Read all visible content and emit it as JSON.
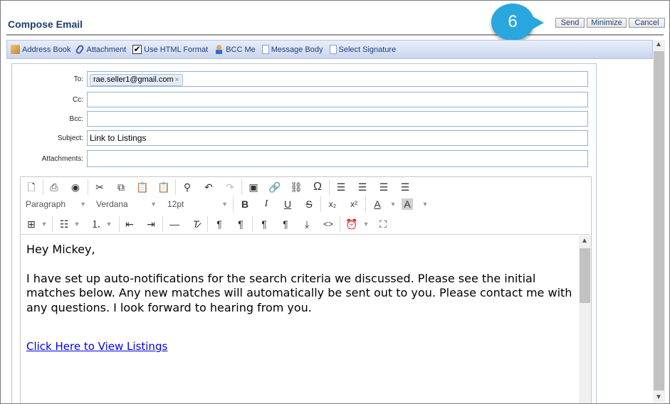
{
  "header": {
    "title": "Compose Email",
    "send_label": "Send",
    "minimize_label": "Minimize",
    "cancel_label": "Cancel",
    "step_number": "6"
  },
  "toolbar": {
    "address_book": "Address Book",
    "attachment": "Attachment",
    "use_html": "Use HTML Format",
    "use_html_checked": true,
    "bcc_me": "BCC Me",
    "message_body": "Message Body",
    "select_signature": "Select Signature"
  },
  "form": {
    "to_label": "To:",
    "to_recipient": "rae.seller1@gmail.com",
    "cc_label": "Cc:",
    "cc_value": "",
    "bcc_label": "Bcc:",
    "bcc_value": "",
    "subject_label": "Subject:",
    "subject_value": "Link to Listings",
    "attachments_label": "Attachments:",
    "attachments_value": ""
  },
  "editor": {
    "paragraph_format": "Paragraph",
    "font_family": "Verdana",
    "font_size": "12pt",
    "greeting": "Hey Mickey,",
    "body": "I have set up auto-notifications for the search criteria we discussed. Please see the initial matches below. Any new matches will automatically be sent out to you. Please contact me with any questions. I look forward to hearing from you.",
    "link_text": "Click Here to View Listings"
  },
  "icons": [
    "new-document-icon",
    "print-icon",
    "preview-icon",
    "cut-icon",
    "copy-icon",
    "paste-icon",
    "paste-text-icon",
    "find-icon",
    "undo-icon",
    "redo-icon",
    "image-icon",
    "link-icon",
    "unlink-icon",
    "special-char-icon",
    "align-left-icon",
    "align-center-icon",
    "align-right-icon",
    "justify-icon",
    "bold-icon",
    "italic-icon",
    "underline-icon",
    "strikethrough-icon",
    "subscript-icon",
    "superscript-icon",
    "text-color-icon",
    "highlight-color-icon",
    "table-icon",
    "bullet-list-icon",
    "numbered-list-icon",
    "outdent-icon",
    "indent-icon",
    "horizontal-rule-icon",
    "clear-format-icon",
    "ltr-icon",
    "rtl-icon",
    "paragraph-mark-icon",
    "show-blocks-icon",
    "insert-icon",
    "source-code-icon",
    "timestamp-icon",
    "fullscreen-icon"
  ],
  "colors": {
    "accent": "#2aa6de",
    "title": "#1f3f6e",
    "toolbar": "#c9d6ee",
    "link": "#0000ee"
  }
}
